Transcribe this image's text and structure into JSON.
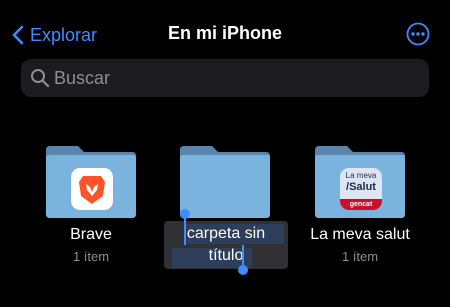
{
  "nav": {
    "back_label": "Explorar",
    "title": "En mi iPhone",
    "more_icon": "ellipsis-circle-icon",
    "accent": "#3f8cff"
  },
  "search": {
    "placeholder": "Buscar",
    "icon": "search-icon"
  },
  "folders": [
    {
      "name": "Brave",
      "count": "1 ítem",
      "app_icon": "brave-lion-icon"
    },
    {
      "name_line1": "carpeta sin",
      "name_line2": "título",
      "editing": true
    },
    {
      "name": "La meva salut",
      "count": "1 ítem",
      "app_icon": "la-meva-salut-icon",
      "app_text1": "La meva",
      "app_text2": "/Salut",
      "app_text3": "gencat"
    }
  ]
}
